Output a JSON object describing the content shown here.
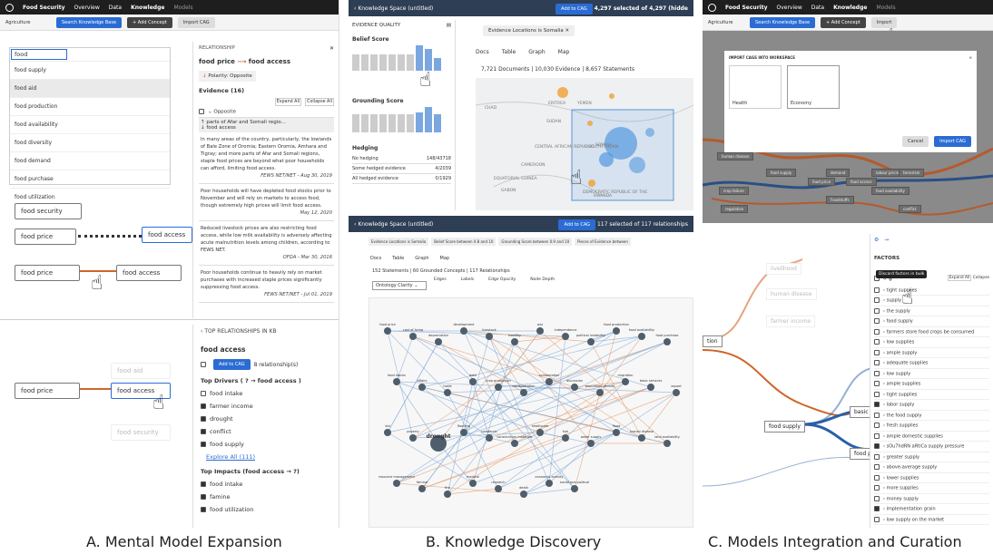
{
  "captions": {
    "a": "A. Mental Model Expansion",
    "b": "B. Knowledge Discovery",
    "c": "C. Models Integration and Curation"
  },
  "colors": {
    "accent": "#2b6cd4",
    "edge_orange": "#d0652a",
    "dark": "#1e1e1e"
  },
  "panel_a": {
    "nav": [
      "Food Security",
      "Overview",
      "Data",
      "Knowledge",
      "Models"
    ],
    "domain": "Agriculture",
    "search_btn": "Search Knowledge Base",
    "add_concept": "+ Add Concept",
    "import_cag": "Import CAG",
    "search_value": "food",
    "dropdown": [
      "food supply",
      "food aid",
      "food production",
      "food availability",
      "food diversity",
      "food demand",
      "food purchase",
      "food utilization"
    ],
    "nodes": {
      "security": "food security",
      "price1": "food price",
      "access1": "food access",
      "price2": "food price",
      "access2": "food access"
    },
    "rel": {
      "header": "RELATIONSHIP",
      "title_from": "food price",
      "title_to": "food access",
      "polarity": "Polarity: Opposite",
      "evidence_label": "Evidence (16)",
      "expand": "Expand All",
      "collapse": "Collapse All",
      "opposite": "Opposite",
      "stmt_a": "parts of Afar and Somali regio...",
      "stmt_b": "food access",
      "evidence": [
        {
          "text": "In many areas of the country, particularly, the lowlands of Bale Zone of Oromia; Eastern Oromia, Amhara and Tigray; and more parts of Afar and Somali regions, staple food prices are beyond what poor households can afford, limiting food access.",
          "src": "FEWS NET/NET - Aug 30, 2019"
        },
        {
          "text": "Poor households will have depleted food stocks prior to November and will rely on markets to access food, though extremely high prices will limit food access.",
          "src": "May 12, 2020"
        },
        {
          "text": "Reduced livestock prices are also restricting food access, while low milk availability is adversely affecting acute malnutrition levels among children, according to FEWS NET.",
          "src": "OFDA - Mar 30, 2016"
        },
        {
          "text": "Poor households continue to heavily rely on market purchases with increased staple prices significantly suppressing food access.",
          "src": "FEWS NET/NET - Jul 01, 2019"
        }
      ]
    },
    "bottom": {
      "nodes": {
        "aid": "food aid",
        "price": "food price",
        "access": "food access",
        "security": "food security"
      },
      "header": "TOP RELATIONSHIPS IN KB",
      "concept": "food access",
      "add_cag": "Add to CAG",
      "rel_count": "8 relationship(s)",
      "drivers_title": "Top Drivers ( ? → food access )",
      "drivers": [
        {
          "label": "food intake",
          "checked": false
        },
        {
          "label": "farmer income",
          "checked": true
        },
        {
          "label": "drought",
          "checked": true
        },
        {
          "label": "conflict",
          "checked": true
        },
        {
          "label": "food supply",
          "checked": true
        }
      ],
      "explore": "Explore All (111)",
      "impacts_title": "Top Impacts (food access → ?)",
      "impacts": [
        {
          "label": "food intake",
          "checked": true
        },
        {
          "label": "famine",
          "checked": true
        },
        {
          "label": "food utilization",
          "checked": true
        }
      ]
    }
  },
  "panel_b": {
    "title": "Knowledge Space (untitled)",
    "add_cag": "Add to CAG",
    "selected": "4,297 selected of 4,297 (hidde",
    "eq_header": "EVIDENCE QUALITY",
    "belief": "Belief Score",
    "grounding": "Grounding Score",
    "hedging": "Hedging",
    "hedge_rows": [
      {
        "label": "No hedging",
        "value": "148/43718"
      },
      {
        "label": "Some hedged evidence",
        "value": "4/2039"
      },
      {
        "label": "All hedged evidence",
        "value": "0/1929"
      }
    ],
    "filter_chip": "Evidence Locations is Somalia",
    "tabs": [
      "Docs",
      "Table",
      "Graph",
      "Map"
    ],
    "counts": "7,721 Documents | 10,030 Evidence | 8,657 Statements",
    "map_labels": [
      "CHAD",
      "ERITREA",
      "YEMEN",
      "SUDAN",
      "SOUTH SUDAN",
      "CENTRAL AFRICAN REPUBLIC",
      "CAMEROON",
      "SOMALI",
      "EQUATORIAL GUINEA",
      "GABON",
      "DEMOCRATIC REPUBLIC OF THE",
      "RWANDA"
    ],
    "graph_title": "Knowledge Space (untitled)",
    "graph_add_cag": "Add to CAG",
    "graph_selected": "117 selected of 117 relationships",
    "graph_filters": [
      "Evidence Locations is Somalia",
      "Belief Score between 0.8 and 10",
      "Grounding Score between 0.9 and 10",
      "Pieces of Evidence between"
    ],
    "graph_counts": "152 Statements | 60 Grounded Concepts | 117 Relationships",
    "ontology": "Ontology Clarity",
    "controls": [
      "Edges",
      "Labels",
      "Edge Opacity",
      "Node Depth"
    ],
    "graph_nodes": [
      "food price",
      "cost of living",
      "depreciation",
      "development",
      "livestock",
      "hostility",
      "war",
      "independence",
      "political instability",
      "food production",
      "food availability",
      "food purchase",
      "food stocks",
      "affairs",
      "trade",
      "debt",
      "crop production",
      "transportation",
      "collaboration",
      "discussion",
      "population density",
      "migration",
      "basic services",
      "export",
      "aid",
      "poverty",
      "drought",
      "flooding",
      "pandemic",
      "construction materials",
      "healthcare",
      "fuel",
      "water supply",
      "flood",
      "human disease",
      "land availability",
      "resource management",
      "famine",
      "fire",
      "medical",
      "research",
      "death",
      "economic activity",
      "social and political"
    ]
  },
  "panel_c": {
    "nav": [
      "Food Security",
      "Overview",
      "Data",
      "Knowledge",
      "Models"
    ],
    "domain": "Agriculture",
    "search_btn": "Search Knowledge Base",
    "add_concept": "+ Add Concept",
    "import_cag": "Import",
    "modal_title": "IMPORT CAGS INTO WORKSPACE",
    "cards": [
      "Health",
      "Economy"
    ],
    "cancel": "Cancel",
    "import_btn": "Import CAG",
    "bg_nodes": [
      "human disease",
      "food supply",
      "food price",
      "food access",
      "crop failure",
      "demand",
      "Foodstuffs",
      "labour pricing",
      "food availability",
      "regulation",
      "terrorism",
      "conflict"
    ],
    "left_nodes": [
      "livelihood",
      "human disease",
      "farmer income",
      "food supply",
      "tion",
      "basic se",
      "food pri"
    ],
    "factors_header": "FACTORS",
    "tooltip": "Discard factors in bulk",
    "expand_all": "Expand All",
    "collapse": "Collapse",
    "factors": [
      {
        "label": "tight supplies",
        "checked": false
      },
      {
        "label": "supply",
        "checked": false
      },
      {
        "label": "the supply",
        "checked": false
      },
      {
        "label": "food supply",
        "checked": false
      },
      {
        "label": "farmers store food crops be consumed",
        "checked": false
      },
      {
        "label": "low supplies",
        "checked": false
      },
      {
        "label": "ample supply",
        "checked": false
      },
      {
        "label": "adequate supplies",
        "checked": false
      },
      {
        "label": "low supply",
        "checked": false
      },
      {
        "label": "ample supplies",
        "checked": false
      },
      {
        "label": "tight supplies",
        "checked": false
      },
      {
        "label": "labor supply",
        "checked": true
      },
      {
        "label": "the food supply",
        "checked": false
      },
      {
        "label": "fresh supplies",
        "checked": false
      },
      {
        "label": "ample domestic supplies",
        "checked": false
      },
      {
        "label": "sOu7hdRN aRtiCa supply pressure",
        "checked": true
      },
      {
        "label": "greater supply",
        "checked": false
      },
      {
        "label": "above-average supply",
        "checked": false
      },
      {
        "label": "lower supplies",
        "checked": false
      },
      {
        "label": "more supplies",
        "checked": false
      },
      {
        "label": "money supply",
        "checked": false
      },
      {
        "label": "implementation grain",
        "checked": true
      },
      {
        "label": "low supply on the market",
        "checked": false
      }
    ]
  }
}
